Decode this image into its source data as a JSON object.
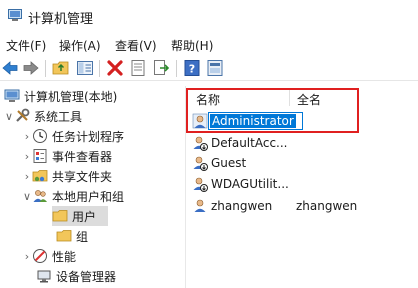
{
  "window": {
    "title": "计算机管理"
  },
  "menu": [
    "文件(F)",
    "操作(A)",
    "查看(V)",
    "帮助(H)"
  ],
  "toolbar": {
    "icons": [
      "back-icon",
      "forward-icon",
      "up-folder-icon",
      "show-hide-tree-icon",
      "delete-icon",
      "properties-icon",
      "export-icon",
      "help-icon",
      "extra-view-icon"
    ]
  },
  "tree": {
    "root": "计算机管理(本地)",
    "system_tools": "系统工具",
    "task_scheduler": "任务计划程序",
    "event_viewer": "事件查看器",
    "shared_folders": "共享文件夹",
    "local_users_groups": "本地用户和组",
    "users": "用户",
    "groups": "组",
    "performance": "性能",
    "device_manager": "设备管理器"
  },
  "list": {
    "columns": [
      "名称",
      "全名"
    ],
    "rows": [
      {
        "name": "Administrator",
        "fullname": ""
      },
      {
        "name": "DefaultAcc...",
        "fullname": ""
      },
      {
        "name": "Guest",
        "fullname": ""
      },
      {
        "name": "WDAGUtilit...",
        "fullname": ""
      },
      {
        "name": "zhangwen",
        "fullname": "zhangwen"
      }
    ]
  },
  "colors": {
    "accent": "#0078d7",
    "highlight_box": "#e02020"
  }
}
